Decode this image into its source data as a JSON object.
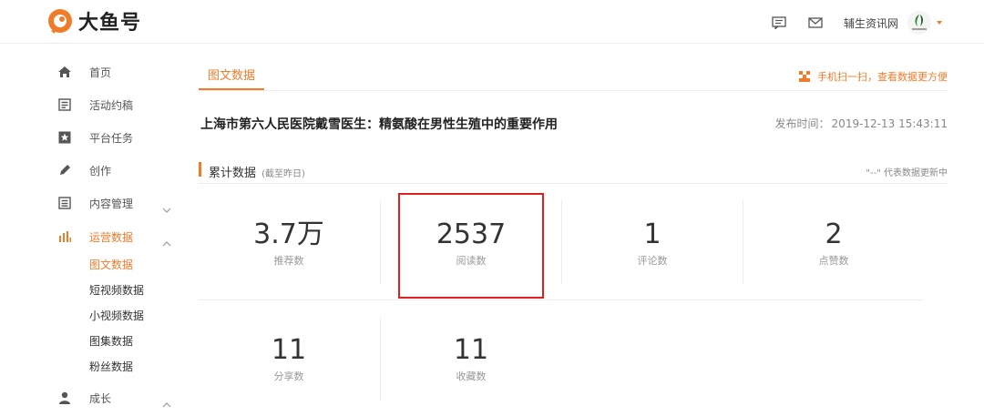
{
  "header": {
    "logo_text": "大鱼号",
    "user_name": "辅生资讯网",
    "icons": [
      "message-icon",
      "mail-icon"
    ],
    "accent_color": "#f07c2a"
  },
  "sidebar": {
    "items": [
      {
        "label": "首页",
        "icon": "home-icon"
      },
      {
        "label": "活动约稿",
        "icon": "document-icon"
      },
      {
        "label": "平台任务",
        "icon": "star-icon"
      },
      {
        "label": "创作",
        "icon": "pen-icon"
      },
      {
        "label": "内容管理",
        "icon": "list-icon"
      },
      {
        "label": "运营数据",
        "icon": "bar-chart-icon"
      },
      {
        "label": "成长",
        "icon": "user-icon"
      }
    ],
    "sub_items": [
      "图文数据",
      "短视频数据",
      "小视频数据",
      "图集数据",
      "粉丝数据"
    ]
  },
  "main": {
    "tab": "图文数据",
    "scan_tip": "手机扫一扫，查看数据更方便",
    "article_title": "上海市第六人民医院戴雪医生：精氨酸在男性生殖中的重要作用",
    "publish_label": "发布时间：",
    "publish_time": "2019-12-13 15:43:11",
    "section_title": "累计数据",
    "section_sub": "(截至昨日)",
    "section_note": "\"--\" 代表数据更新中",
    "stats": [
      {
        "value": "3.7万",
        "label": "推荐数"
      },
      {
        "value": "2537",
        "label": "阅读数"
      },
      {
        "value": "1",
        "label": "评论数"
      },
      {
        "value": "2",
        "label": "点赞数"
      },
      {
        "value": "11",
        "label": "分享数"
      },
      {
        "value": "11",
        "label": "收藏数"
      }
    ]
  }
}
